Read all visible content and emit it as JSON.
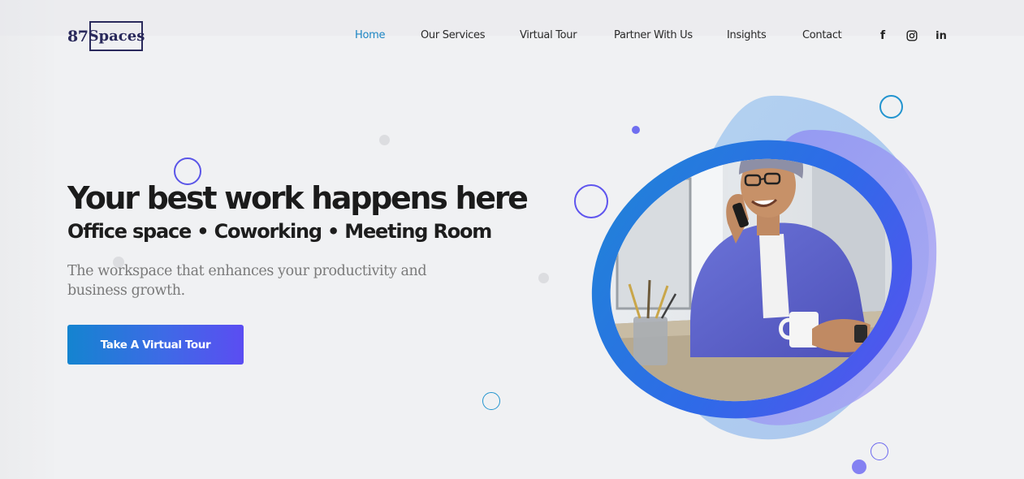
{
  "logo": {
    "number": "87",
    "word": "Spaces"
  },
  "nav": {
    "items": [
      {
        "label": "Home",
        "active": true
      },
      {
        "label": "Our Services"
      },
      {
        "label": "Virtual Tour"
      },
      {
        "label": "Partner With Us"
      },
      {
        "label": "Insights"
      },
      {
        "label": "Contact"
      }
    ]
  },
  "social": {
    "facebook": {
      "icon": "facebook-icon",
      "glyph": "f"
    },
    "instagram": {
      "icon": "instagram-icon"
    },
    "linkedin": {
      "icon": "linkedin-icon",
      "glyph": "in"
    }
  },
  "hero": {
    "headline": "Your best work happens here",
    "subhead": "Office space • Coworking • Meeting Room",
    "description": "The workspace that enhances your productivity and business growth.",
    "cta_label": "Take A Virtual Tour",
    "image": "man-on-phone-at-desk"
  },
  "colors": {
    "accent": "#1d86c4",
    "gradient_start": "#1484d0",
    "gradient_end": "#5b4df2",
    "background": "#f0f1f3"
  }
}
